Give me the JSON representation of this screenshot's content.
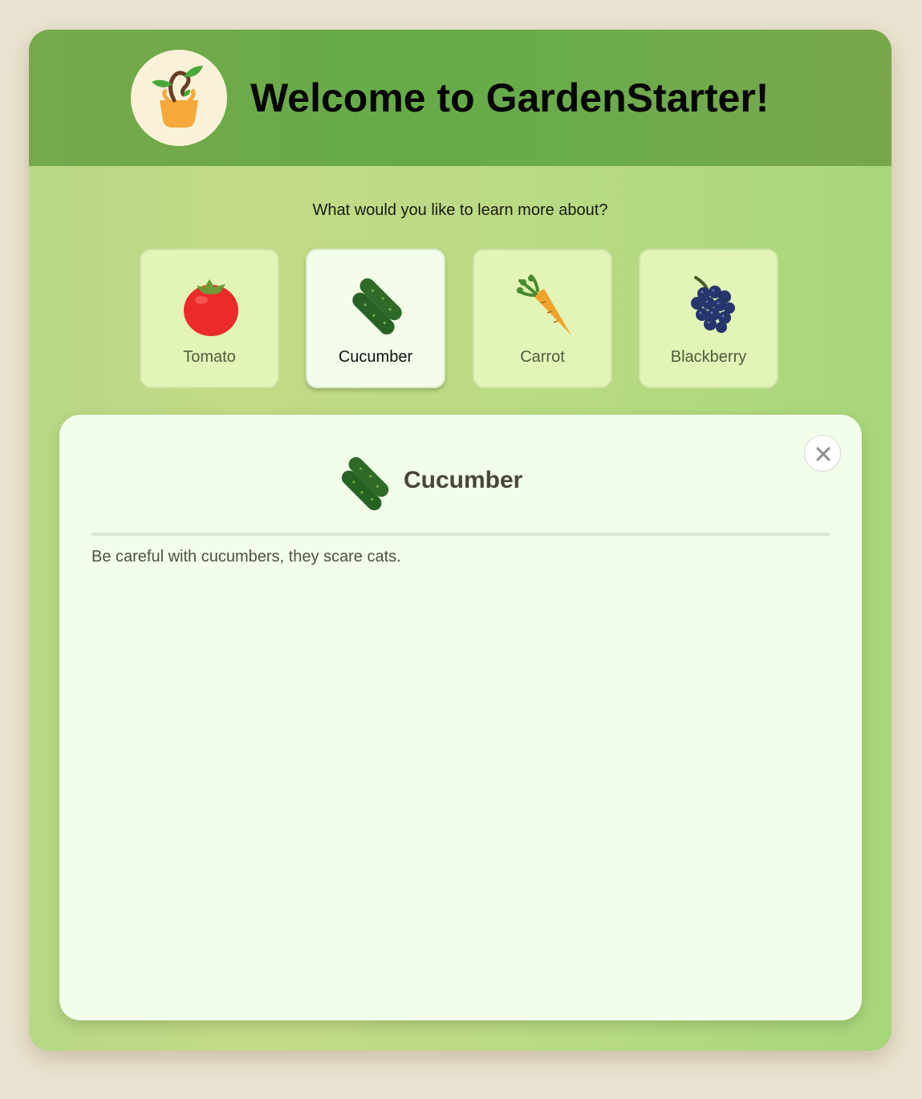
{
  "header": {
    "title": "Welcome to GardenStarter!",
    "logo_icon": "plant-basket-icon"
  },
  "prompt": "What would you like to learn more about?",
  "plants": [
    {
      "label": "Tomato",
      "icon": "tomato-icon",
      "selected": false
    },
    {
      "label": "Cucumber",
      "icon": "cucumber-icon",
      "selected": true
    },
    {
      "label": "Carrot",
      "icon": "carrot-icon",
      "selected": false
    },
    {
      "label": "Blackberry",
      "icon": "blackberry-icon",
      "selected": false
    }
  ],
  "detail": {
    "title": "Cucumber",
    "icon": "cucumber-icon",
    "text": "Be careful with cucumbers, they scare cats.",
    "close_icon": "close-icon"
  },
  "colors": {
    "page_background": "#ebe3d1",
    "header_green": "#65ab48",
    "body_green": "#c4da87",
    "card_background": "#e2f5b6",
    "selected_card_background": "#f3fde9",
    "panel_background": "#f2fdea"
  }
}
